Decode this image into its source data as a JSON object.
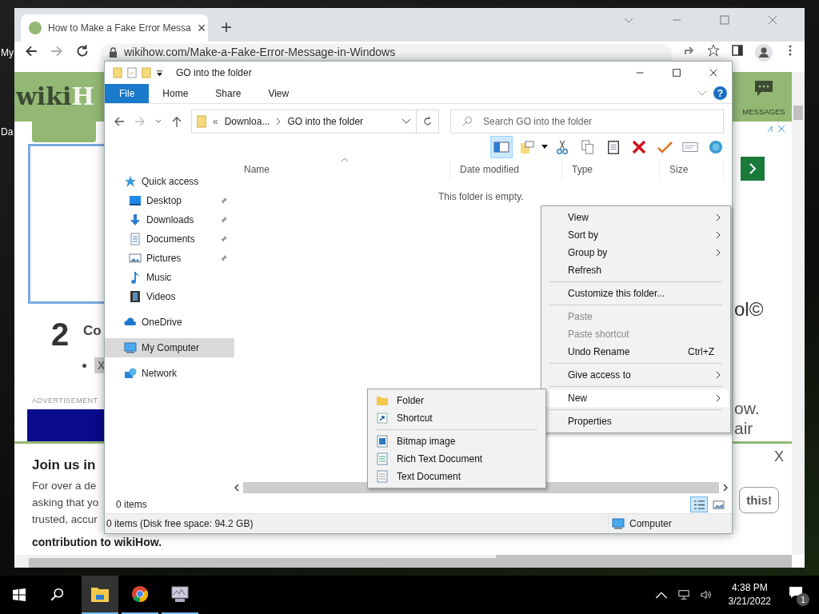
{
  "desktop": {
    "icon_labels": [
      "My",
      "Da"
    ]
  },
  "browser": {
    "tab": {
      "title": "How to Make a Fake Error Messa",
      "close": "×",
      "selected": true
    },
    "new_tab": "+",
    "url": "wikihow.com/Make-a-Fake-Error-Message-in-Windows",
    "page": {
      "logo": {
        "dark": "wiki",
        "light": "H"
      },
      "messages": "MESSAGES",
      "step_number": "2",
      "step_title": "Co",
      "bullet_text": "X",
      "ad_label": "ADVERTISEMENT",
      "right_texts": [
        "ol©",
        "ow.",
        "air"
      ],
      "banner": {
        "title": "Join us in",
        "lines": [
          "For over a de",
          "asking that yo",
          "trusted, accur"
        ],
        "bold_line": "contribution to wikiHow.",
        "button": "this!",
        "close": "X"
      }
    }
  },
  "explorer": {
    "title": "GO into the folder",
    "ribbon_tabs": [
      {
        "label": "File",
        "selected": true
      },
      {
        "label": "Home",
        "selected": false
      },
      {
        "label": "Share",
        "selected": false
      },
      {
        "label": "View",
        "selected": false
      }
    ],
    "help": "?",
    "breadcrumb": [
      "«",
      "Downloa...",
      "GO into the folder"
    ],
    "search": {
      "placeholder": "Search GO into the folder"
    },
    "columns": [
      "Name",
      "Date modified",
      "Type",
      "Size"
    ],
    "empty_message": "This folder is empty.",
    "nav": [
      {
        "label": "Quick access",
        "selected": false,
        "children": [
          {
            "label": "Desktop",
            "pinned": true,
            "selected": false
          },
          {
            "label": "Downloads",
            "pinned": true,
            "selected": false
          },
          {
            "label": "Documents",
            "pinned": true,
            "selected": false
          },
          {
            "label": "Pictures",
            "pinned": true,
            "selected": false
          },
          {
            "label": "Music",
            "pinned": false,
            "selected": false
          },
          {
            "label": "Videos",
            "pinned": false,
            "selected": false
          }
        ]
      },
      {
        "label": "OneDrive",
        "selected": false
      },
      {
        "label": "My Computer",
        "selected": true
      },
      {
        "label": "Network",
        "selected": false
      }
    ],
    "item_count": "0 items",
    "views": [
      {
        "selected": true
      },
      {
        "selected": false
      }
    ],
    "status": "0 items (Disk free space: 94.2 GB)",
    "status_location": "Computer"
  },
  "context_menu": [
    {
      "kind": "item",
      "label": "View",
      "submenu": true,
      "selected": false
    },
    {
      "kind": "item",
      "label": "Sort by",
      "submenu": true,
      "selected": false
    },
    {
      "kind": "item",
      "label": "Group by",
      "submenu": true,
      "selected": false
    },
    {
      "kind": "item",
      "label": "Refresh",
      "submenu": false,
      "selected": false
    },
    {
      "kind": "separator"
    },
    {
      "kind": "item",
      "label": "Customize this folder...",
      "submenu": false,
      "selected": false
    },
    {
      "kind": "separator"
    },
    {
      "kind": "item",
      "label": "Paste",
      "submenu": false,
      "disabled": true,
      "selected": false
    },
    {
      "kind": "item",
      "label": "Paste shortcut",
      "submenu": false,
      "disabled": true,
      "selected": false
    },
    {
      "kind": "item",
      "label": "Undo Rename",
      "shortcut": "Ctrl+Z",
      "submenu": false,
      "selected": false
    },
    {
      "kind": "separator"
    },
    {
      "kind": "item",
      "label": "Give access to",
      "submenu": true,
      "selected": false
    },
    {
      "kind": "separator"
    },
    {
      "kind": "item",
      "label": "New",
      "submenu": true,
      "selected": true
    },
    {
      "kind": "separator"
    },
    {
      "kind": "item",
      "label": "Properties",
      "submenu": false,
      "selected": false
    }
  ],
  "new_submenu": [
    {
      "kind": "item",
      "label": "Folder"
    },
    {
      "kind": "item",
      "label": "Shortcut"
    },
    {
      "kind": "separator"
    },
    {
      "kind": "item",
      "label": "Bitmap image"
    },
    {
      "kind": "item",
      "label": "Rich Text Document"
    },
    {
      "kind": "item",
      "label": "Text Document"
    }
  ],
  "taskbar": {
    "apps": [
      {
        "selected": true
      },
      {
        "selected": false
      },
      {
        "selected": false
      }
    ],
    "time": "4:38 PM",
    "date": "3/21/2022",
    "notifications": "1"
  }
}
